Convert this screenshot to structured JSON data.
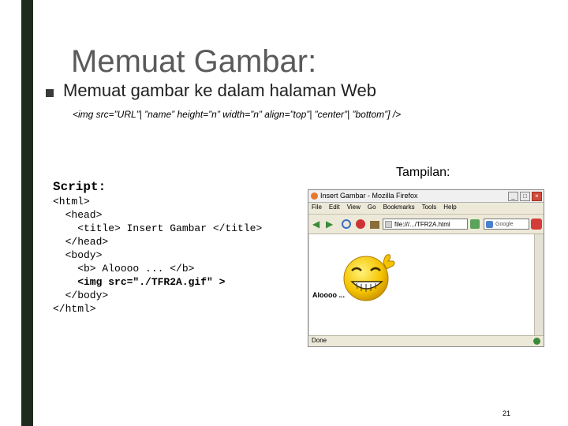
{
  "slide": {
    "title": "Memuat Gambar:",
    "bullet": "Memuat gambar ke dalam halaman Web",
    "syntax": "<img src=”URL”| ”name” height=”n” width=”n” align=”top”| ”center”| ”bottom”] />",
    "script_label": "Script:",
    "code_lines": [
      "<html>",
      "  <head>",
      "    <title> Insert Gambar </title>",
      "  </head>",
      "  <body>",
      "    <b> Aloooo ... </b>",
      "    <img src=\"./TFR2A.gif\" >",
      "  </body>",
      "</html>"
    ],
    "preview_label": "Tampilan:",
    "page_number": "21"
  },
  "browser": {
    "window_title": "Insert Gambar - Mozilla Firefox",
    "menu": [
      "File",
      "Edit",
      "View",
      "Go",
      "Bookmarks",
      "Tools",
      "Help"
    ],
    "url": "file:///.../TFR2A.html",
    "search_placeholder": "Google",
    "page_text": "Aloooo ... ",
    "status_text": "Done",
    "window_buttons": {
      "minimize": "_",
      "maximize": "□",
      "close": "×"
    },
    "back_label": "◀",
    "forward_label": "▶",
    "icons": {
      "app": "firefox-icon",
      "back": "back-arrow-icon",
      "forward": "forward-arrow-icon",
      "reload": "reload-icon",
      "stop": "stop-icon",
      "home": "home-icon",
      "go": "go-icon",
      "search": "google-icon",
      "status": "status-icon"
    }
  },
  "colors": {
    "left_bar": "#1f2a1f",
    "title": "#5a5a5a",
    "smiley_face": "#f5c400",
    "close_button": "#d04a3a"
  }
}
